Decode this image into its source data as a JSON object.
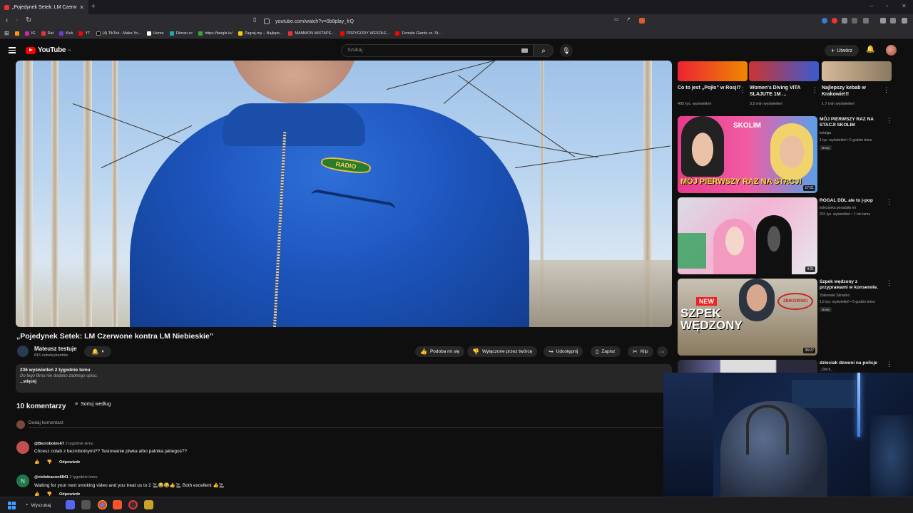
{
  "browser": {
    "tab_title": "„Pojedynek Setek: LM Czerw",
    "url": "youtube.com/watch?v=0b8play_frQ",
    "bookmarks": [
      {
        "label": "IG",
        "color": "#d6249f"
      },
      {
        "label": "Rat",
        "color": "#e33"
      },
      {
        "label": "Kick",
        "color": "#6a3fd0"
      },
      {
        "label": "YT",
        "color": "#f00"
      },
      {
        "label": "(4) TikTok - Make Yo...",
        "color": "#111"
      },
      {
        "label": "Home",
        "color": "#fff"
      },
      {
        "label": "Filman.cc",
        "color": "#2aa"
      },
      {
        "label": "https://tangle.io/",
        "color": "#3a3"
      },
      {
        "label": "Zagraj.my – Najleps...",
        "color": "#fc0"
      },
      {
        "label": "MAMMON MIXTAPE...",
        "color": "#e33"
      },
      {
        "label": "PRZYGODY WESOŁE...",
        "color": "#f00"
      },
      {
        "label": "Female Giants vs. St...",
        "color": "#f00"
      }
    ]
  },
  "header": {
    "logo_text": "YouTube",
    "logo_country": "PL",
    "search_placeholder": "Szukaj",
    "create_label": "Utwórz"
  },
  "video": {
    "jacket_badge": "RADIO",
    "title": "„Pojedynek Setek: LM Czerwone kontra LM Niebieskie”",
    "channel_name": "Mateusz testuje",
    "channel_subs": "816 subskrybentów",
    "actions": {
      "like": "Podoba mi się",
      "dislike": "Wyłączone przez twórcę",
      "share": "Udostępnij",
      "save": "Zapisz",
      "clip": "Klip"
    },
    "description": {
      "stats": "236 wyświetleń  2 tygodnie temu",
      "body": "Do tego filmu nie dodano żadnego opisu.",
      "more": "...więcej"
    }
  },
  "comments": {
    "count_label": "10 komentarzy",
    "sort_label": "Sortuj według",
    "add_placeholder": "Dodaj komentarz",
    "items": [
      {
        "author": "@Bezrobotni-67",
        "time": "2 tygodnie temu",
        "text": "Chcesz colab z bezrobotnymi?? Testowanie piwka albo palnika jakiegoś??",
        "reply": "Odpowiedz",
        "avatar_letter": "",
        "avatar_color": "#c0504d"
      },
      {
        "author": "@nickdeacon6841",
        "time": "2 tygodnie temu",
        "text": "Waiting for your next smoking video and you treat us to 2 🚬😂😂👍🚬 Both excellent 👍🚬",
        "reply": "Odpowiedz",
        "avatar_letter": "N",
        "avatar_color": "#1e7a4a"
      }
    ]
  },
  "sidebar": {
    "top_row": [
      {
        "title": "Co to jest „Pojło” w Rosji?",
        "views": "405 tys. wyświetleń"
      },
      {
        "title": "Women's Diving VITA SLAJUTE 1M ...",
        "views": "3,5 mln wyświetleń"
      },
      {
        "title": "Najlepszy kebab w Krakowie!!!",
        "views": "1,7 mln wyświetleń"
      }
    ],
    "videos": [
      {
        "title": "MÓJ PIERWSZY RAZ NA STACJI SKOLIM",
        "channel": "kotolga",
        "meta": "1 tys. wyświetleń • 5 godzin temu",
        "badge": "Nowy",
        "duration": "17:01",
        "thumb_text": "MÓJ PIERWSZY RAZ NA STACJI",
        "thumb_label": "SKOLIM"
      },
      {
        "title": "ROGAL DDL ale to j-pop",
        "channel": "koleżanka poradziła mi",
        "meta": "201 tys. wyświetleń • 1 rok temu",
        "badge": "",
        "duration": "4:01",
        "thumb_text": "",
        "thumb_label": ""
      },
      {
        "title": "Szpek wędzony z przyprawami w konserwie.",
        "channel": "Zbikowski Skrwilno",
        "meta": "1,6 tys. wyświetleń • 6 godzin temu",
        "badge": "Nowy",
        "duration": "36:07",
        "thumb_text": "SZPEK WĘDZONY",
        "thumb_label": "NEW"
      },
      {
        "title": "dzieciak dzwoni na policje",
        "channel": "_Okick_",
        "meta": "",
        "badge": "",
        "duration": "",
        "thumb_text": "",
        "thumb_label": ""
      }
    ]
  },
  "taskbar": {
    "search_label": "Wyszukaj"
  }
}
